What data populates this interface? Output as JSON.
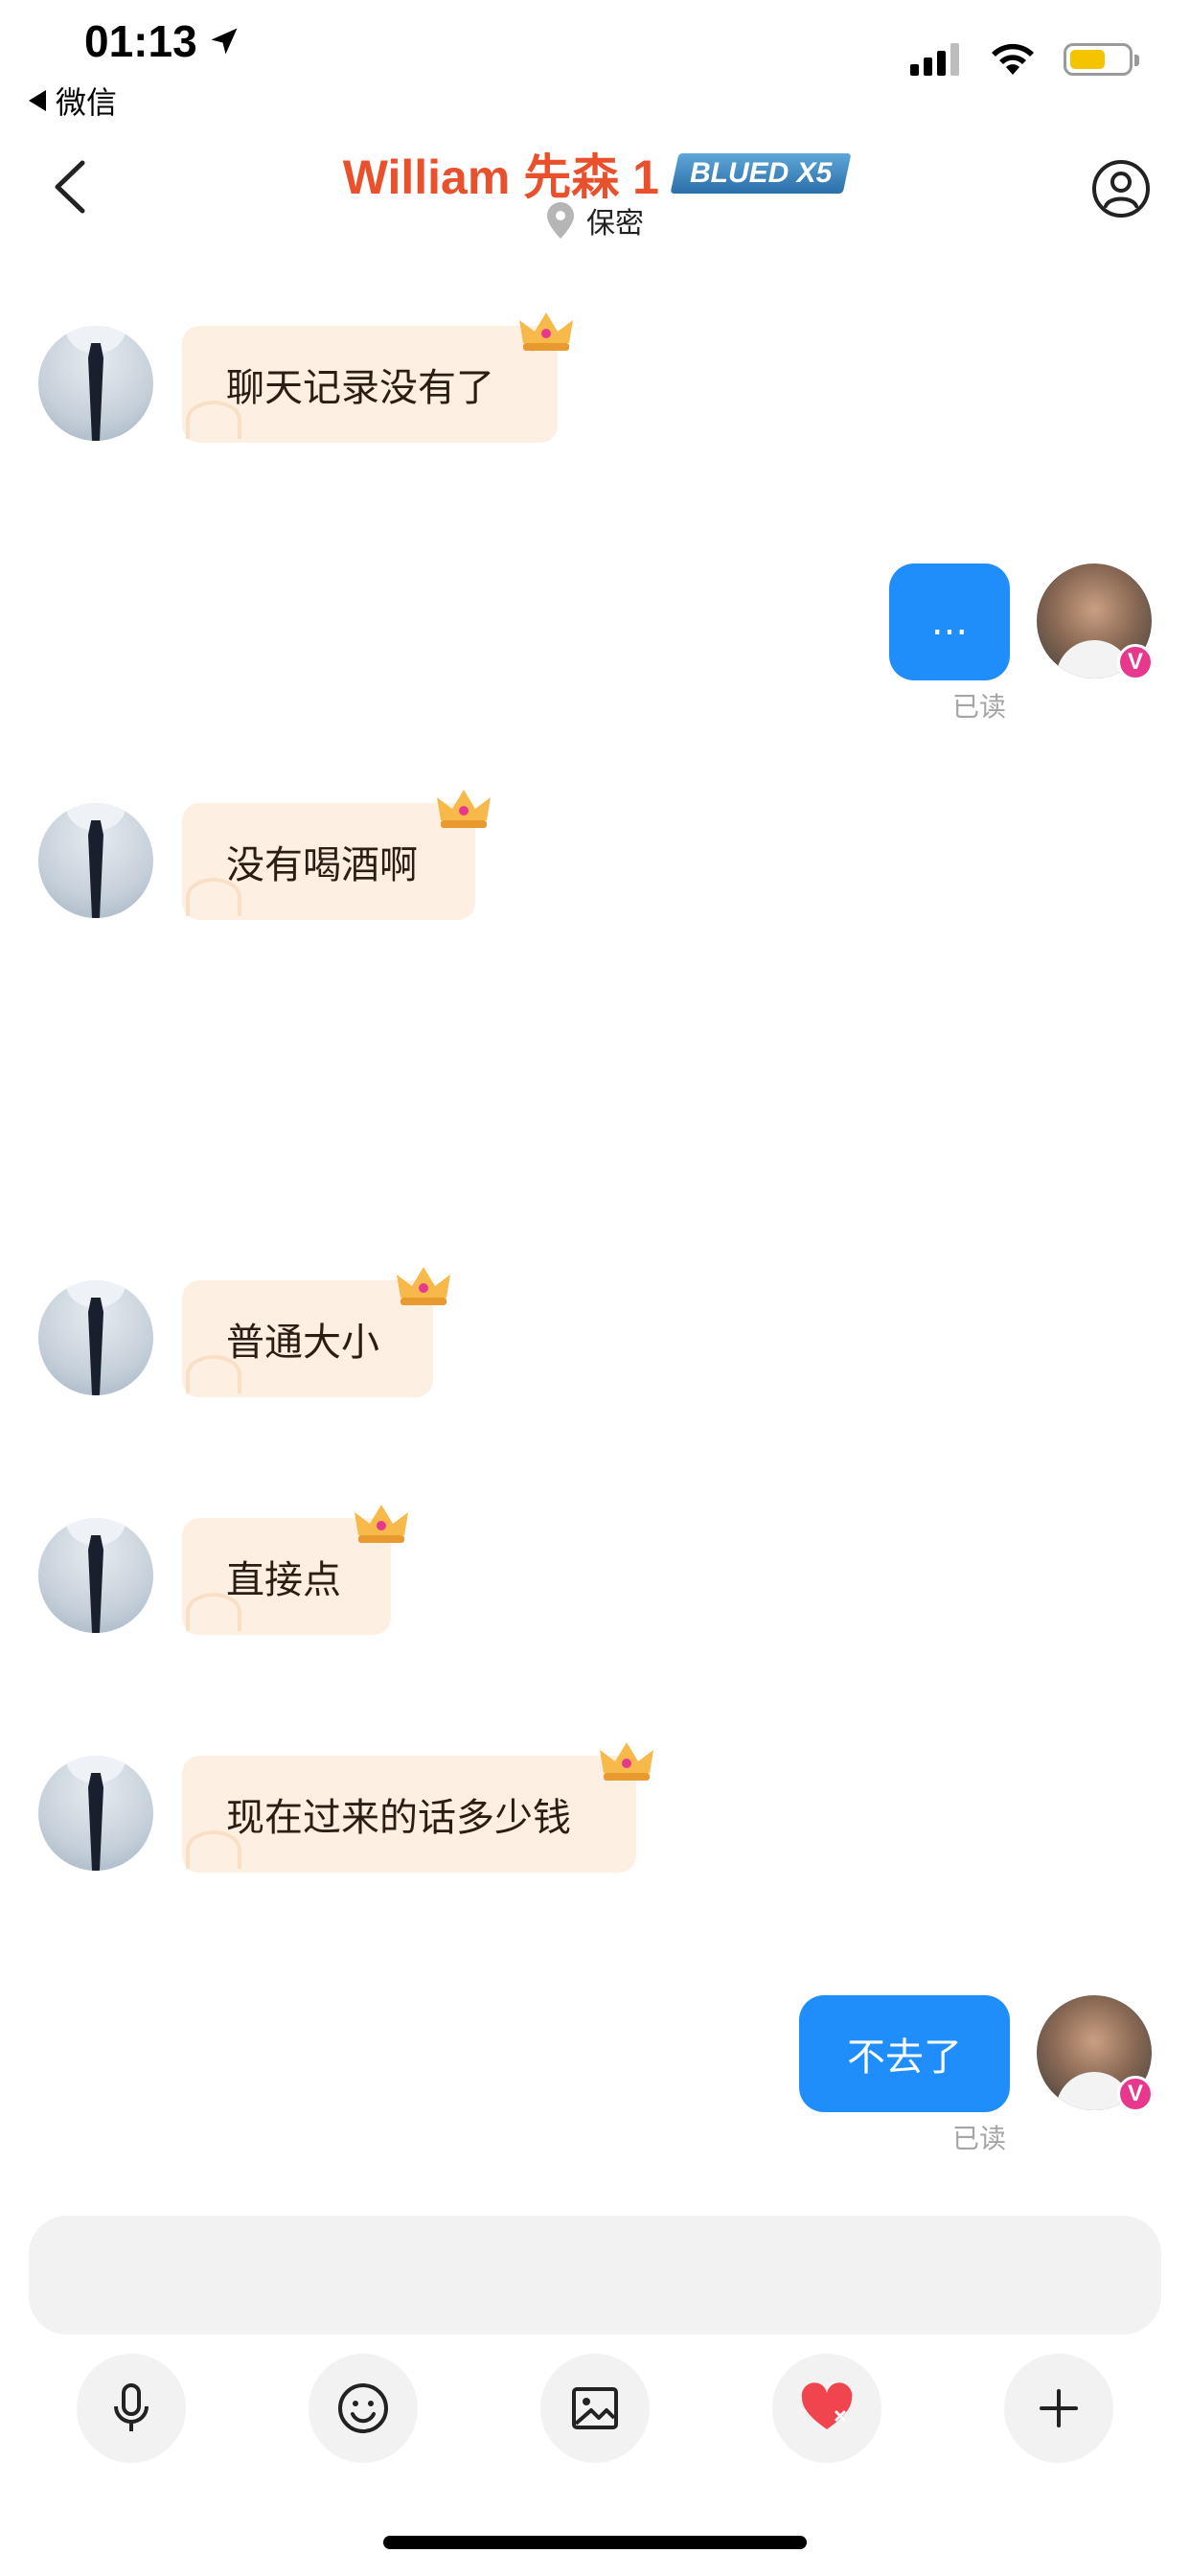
{
  "status_bar": {
    "time": "01:13",
    "back_app_label": "微信"
  },
  "header": {
    "title": "William 先森 1",
    "badge": "BLUED X5",
    "location": "保密"
  },
  "messages": [
    {
      "side": "in",
      "text": "聊天记录没有了"
    },
    {
      "side": "out",
      "text": "...",
      "status": "已读"
    },
    {
      "side": "in",
      "text": "没有喝酒啊"
    },
    {
      "side": "in",
      "text": "普通大小"
    },
    {
      "side": "in",
      "text": "直接点"
    },
    {
      "side": "in",
      "text": "现在过来的话多少钱"
    },
    {
      "side": "out",
      "text": "不去了",
      "status": "已读"
    }
  ],
  "user_badge": "V",
  "toolbar": {
    "icons": [
      "microphone-icon",
      "emoji-icon",
      "image-icon",
      "heart-icon",
      "plus-icon"
    ]
  },
  "colors": {
    "title": "#e8512c",
    "outgoing_bubble": "#1f8efa",
    "incoming_bubble": "#fdf0e3",
    "badge_pink": "#e8388d",
    "battery": "#f5c400"
  }
}
